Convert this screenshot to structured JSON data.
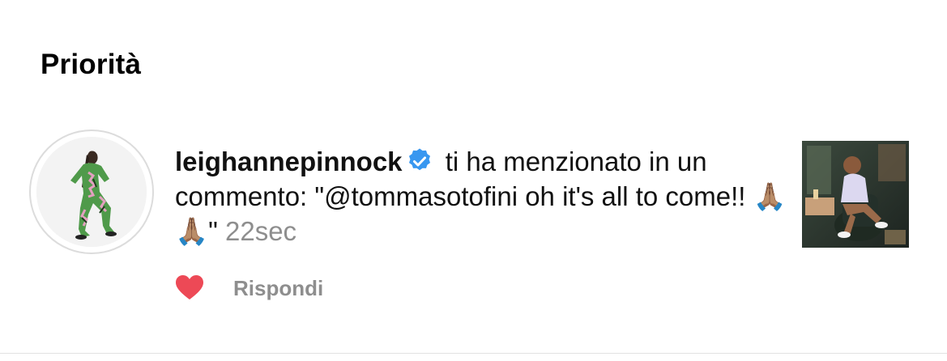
{
  "section": {
    "title": "Priorità"
  },
  "notification": {
    "username": "leighannepinnock",
    "verified": true,
    "message": " ti ha menzionato in un commento: \"@tommasotofini oh it's all to come!! 🙏🏽🙏🏽\"",
    "timestamp": "22sec",
    "reply_label": "Rispondi"
  },
  "icons": {
    "verified": "verified-badge-icon",
    "like": "heart-icon"
  },
  "colors": {
    "verified_blue": "#3897f0",
    "like_red": "#ed4956",
    "secondary_text": "#8e8e8e"
  }
}
